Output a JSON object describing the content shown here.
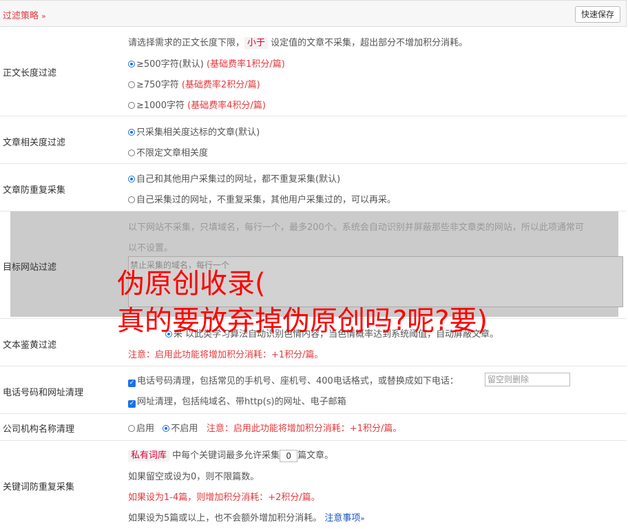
{
  "header": {
    "title": "过滤策略",
    "chevron": "»",
    "save_label": "快速保存"
  },
  "length_filter": {
    "label": "正文长度过滤",
    "desc_a": "请选择需求的正文长度下限，",
    "desc_tag": "小于",
    "desc_b": "设定值的文章不采集，超出部分不增加积分消耗。",
    "options": [
      {
        "label": "≥500字符(默认)",
        "note": "(基础费率1积分/篇)",
        "checked": true
      },
      {
        "label": "≥750字符",
        "note": "(基础费率2积分/篇)",
        "checked": false
      },
      {
        "label": "≥1000字符",
        "note": "(基础费率4积分/篇)",
        "checked": false
      }
    ]
  },
  "relevance_filter": {
    "label": "文章相关度过滤",
    "options": [
      {
        "label": "只采集相关度达标的文章(默认)",
        "checked": true
      },
      {
        "label": "不限定文章相关度",
        "checked": false
      }
    ]
  },
  "dedup_filter": {
    "label": "文章防重复采集",
    "options": [
      {
        "label": "自己和其他用户采集过的网址，都不重复采集(默认)",
        "checked": true
      },
      {
        "label": "自己采集过的网址，不重复采集，其他用户采集过的，可以再采。",
        "checked": false
      }
    ]
  },
  "site_filter": {
    "label": "目标网站过滤",
    "desc_line1": "以下网站不采集，只填域名，每行一个，最多200个。系统会自动识别并屏蔽那些非文章类的网站，所以此项通常可",
    "desc_line2": "以不设置。",
    "placeholder": "禁止采集的域名，每行一个"
  },
  "watermark": {
    "line1": "伪原创收录(",
    "line2": "真的要放弃掉伪原创吗?呢?要)"
  },
  "porn_filter": {
    "label": "文本鉴黄过滤",
    "partial_text": "采    以此类学习算法自动识别色情内容，当色情概率达到系统阈值，自动屏蔽文章。",
    "note": "注意：启用此功能将增加积分消耗：+1积分/篇。"
  },
  "phone_url_clean": {
    "label": "电话号码和网址清理",
    "phone_text": "电话号码清理，包括常见的手机号、座机号、400电话格式，或替换成如下电话：",
    "phone_placeholder": "留空则删除",
    "url_text": "网址清理，包括纯域名、带http(s)的网址、电子邮箱"
  },
  "org_clean": {
    "label": "公司机构名称清理",
    "enable": "启用",
    "disable": "不启用",
    "note": "注意：启用此功能将增加积分消耗：+1积分/篇。"
  },
  "keyword_dedup": {
    "label": "关键词防重复采集",
    "tag": "私有词库",
    "text_a": "中每个关键词最多允许采集",
    "value": "0",
    "text_b": "篇文章。",
    "line2": "如果留空或设为0，则不限篇数。",
    "line3": "如果设为1-4篇，则增加积分消耗：+2积分/篇。",
    "line4": "如果设为5篇或以上，也不会额外增加积分消耗。",
    "link": "注意事项",
    "link_chevron": "»"
  }
}
